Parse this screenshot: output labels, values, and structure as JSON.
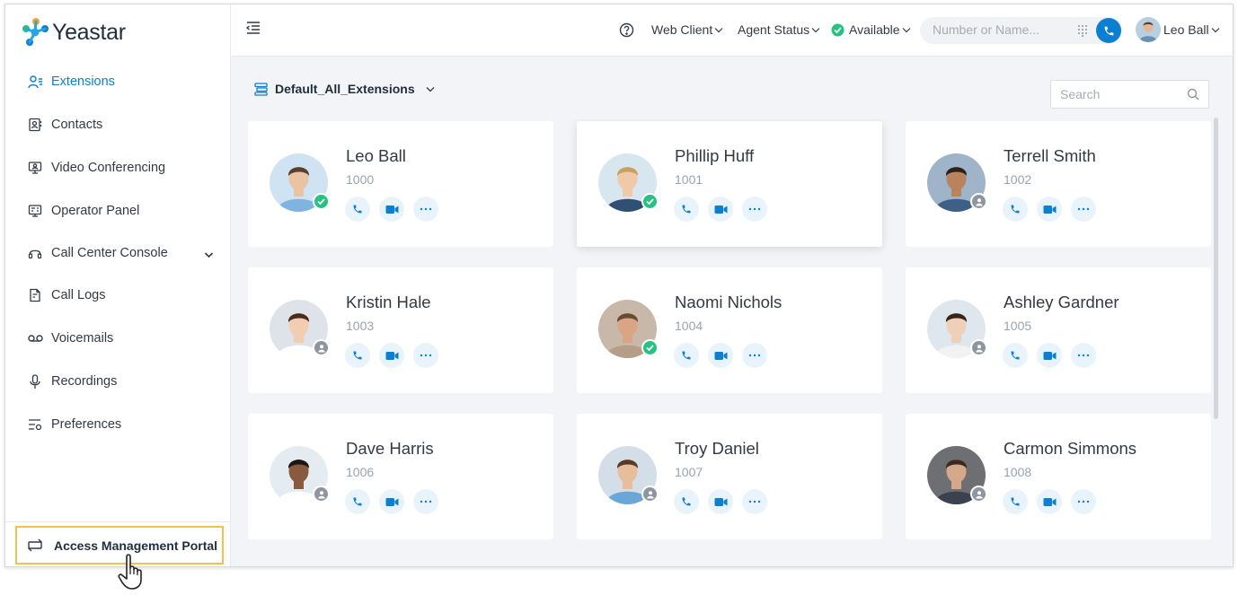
{
  "app": {
    "brand": "Yeastar"
  },
  "colors": {
    "accent": "#0b7fd1",
    "available": "#26c281",
    "offline": "#8e959e",
    "highlight": "#f0c24b"
  },
  "sidebar": {
    "items": [
      {
        "label": "Extensions",
        "icon": "extensions-icon",
        "active": true
      },
      {
        "label": "Contacts",
        "icon": "contacts-icon"
      },
      {
        "label": "Video Conferencing",
        "icon": "video-conferencing-icon"
      },
      {
        "label": "Operator Panel",
        "icon": "operator-panel-icon"
      },
      {
        "label": "Call Center Console",
        "icon": "headset-icon",
        "expandable": true
      },
      {
        "label": "Call Logs",
        "icon": "call-logs-icon"
      },
      {
        "label": "Voicemails",
        "icon": "voicemail-icon"
      },
      {
        "label": "Recordings",
        "icon": "microphone-icon"
      },
      {
        "label": "Preferences",
        "icon": "preferences-icon"
      }
    ],
    "portal_label": "Access Management Portal"
  },
  "header": {
    "web_client": "Web Client",
    "agent_status": "Agent Status",
    "presence": "Available",
    "search_placeholder": "Number or Name...",
    "user_name": "Leo Ball"
  },
  "main": {
    "group": "Default_All_Extensions",
    "search_placeholder": "Search",
    "extensions": [
      {
        "name": "Leo Ball",
        "number": "1000",
        "status": "available"
      },
      {
        "name": "Phillip Huff",
        "number": "1001",
        "status": "available"
      },
      {
        "name": "Terrell Smith",
        "number": "1002",
        "status": "offline"
      },
      {
        "name": "Kristin Hale",
        "number": "1003",
        "status": "offline"
      },
      {
        "name": "Naomi Nichols",
        "number": "1004",
        "status": "available"
      },
      {
        "name": "Ashley Gardner",
        "number": "1005",
        "status": "offline"
      },
      {
        "name": "Dave Harris",
        "number": "1006",
        "status": "offline"
      },
      {
        "name": "Troy Daniel",
        "number": "1007",
        "status": "offline"
      },
      {
        "name": "Carmon Simmons",
        "number": "1008",
        "status": "offline"
      }
    ]
  }
}
